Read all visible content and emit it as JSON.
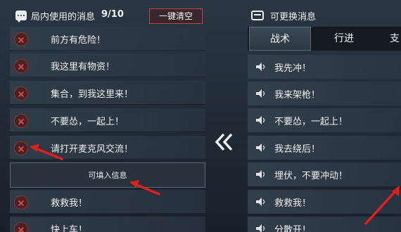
{
  "left_panel": {
    "title": "局内使用的消息",
    "count": "9/10",
    "clear_button": "一键清空",
    "messages": [
      "前方有危险！",
      "我这里有物资！",
      "集合，到我这里来！",
      "不要怂，一起上！",
      "请打开麦克风交流！",
      "救救我！",
      "快上车！"
    ],
    "fill_in_label": "可填入信息"
  },
  "right_panel": {
    "title": "可更换消息",
    "tabs": [
      "战术",
      "行进",
      "支"
    ],
    "active_tab": "战术",
    "messages": [
      "我先冲！",
      "我来架枪！",
      "不要怂，一起上！",
      "我去绕后！",
      "埋伏，不要冲动！",
      "救救我！",
      "分散开！"
    ]
  },
  "icons": {
    "left_header": "chat-bubble-icon",
    "right_header": "keyboard-icon",
    "delete": "delete-x-icon",
    "speaker": "speaker-icon",
    "transfer": "double-chevron-left-icon"
  },
  "colors": {
    "delete_red": "#d14a4a",
    "annotation_arrow": "#e0201d",
    "clear_border": "#b94a4a"
  }
}
